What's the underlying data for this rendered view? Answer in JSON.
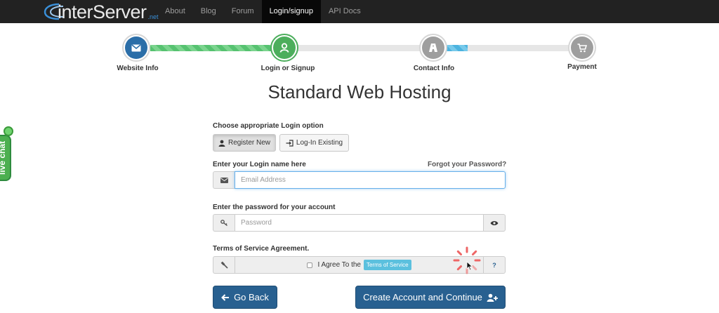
{
  "nav": {
    "logo_text": "interServer",
    "logo_suffix": ".net",
    "items": [
      {
        "label": "About"
      },
      {
        "label": "Blog"
      },
      {
        "label": "Forum"
      },
      {
        "label": "Login/signup",
        "active": true
      },
      {
        "label": "API Docs"
      }
    ]
  },
  "steps": [
    {
      "label": "Website Info",
      "icon": "envelope-icon",
      "state": "complete",
      "color": "#2b6ea8"
    },
    {
      "label": "Login or Signup",
      "icon": "user-icon",
      "state": "current",
      "color": "#4cae5c"
    },
    {
      "label": "Contact Info",
      "icon": "road-icon",
      "state": "pending",
      "color": "#9e9e9e"
    },
    {
      "label": "Payment",
      "icon": "cart-icon",
      "state": "pending",
      "color": "#9e9e9e"
    }
  ],
  "page_title": "Standard Web Hosting",
  "login_option": {
    "label": "Choose appropriate Login option",
    "register_label": "Register New",
    "login_label": "Log-In Existing",
    "selected": "Register New"
  },
  "login_name": {
    "label": "Enter your Login name here",
    "forgot_label": "Forgot your Password?",
    "placeholder": "Email Address",
    "value": ""
  },
  "password": {
    "label": "Enter the password for your account",
    "placeholder": "Password",
    "value": ""
  },
  "tos": {
    "label": "Terms of Service Agreement.",
    "agree_text": "I Agree To the",
    "badge": "Terms of Service",
    "help": "?",
    "checked": false
  },
  "buttons": {
    "back": "Go Back",
    "continue": "Create Account and Continue"
  },
  "livechat": {
    "label": "live chat"
  },
  "colors": {
    "primary": "#286090",
    "info": "#5bc0de",
    "success": "#4cae5c",
    "nav_bg": "#222222"
  }
}
